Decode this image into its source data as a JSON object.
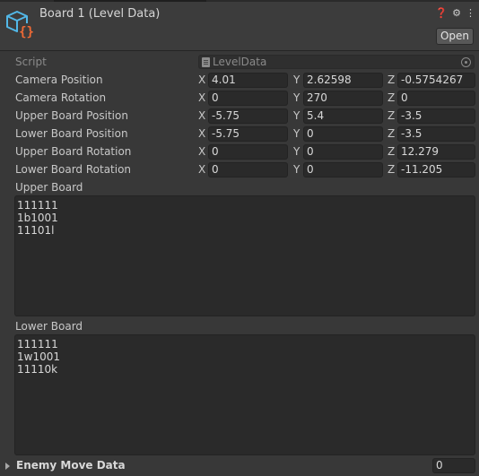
{
  "header": {
    "title": "Board 1 (Level Data)",
    "open_label": "Open",
    "icons": [
      "help-icon",
      "settings-sliders-icon",
      "more-vert-icon"
    ]
  },
  "script": {
    "label": "Script",
    "value": "LevelData"
  },
  "vectors": [
    {
      "label": "Camera Position",
      "x": "4.01",
      "y": "2.62598",
      "z": "-0.5754267"
    },
    {
      "label": "Camera Rotation",
      "x": "0",
      "y": "270",
      "z": "0"
    },
    {
      "label": "Upper Board Position",
      "x": "-5.75",
      "y": "5.4",
      "z": "-3.5"
    },
    {
      "label": "Lower Board Position",
      "x": "-5.75",
      "y": "0",
      "z": "-3.5"
    },
    {
      "label": "Upper Board Rotation",
      "x": "0",
      "y": "0",
      "z": "12.279"
    },
    {
      "label": "Lower Board Rotation",
      "x": "0",
      "y": "0",
      "z": "-11.205"
    }
  ],
  "axis_labels": {
    "x": "X",
    "y": "Y",
    "z": "Z"
  },
  "upper_board": {
    "label": "Upper Board",
    "lines": [
      "111111",
      "1b1001",
      "11101l"
    ]
  },
  "lower_board": {
    "label": "Lower Board",
    "lines": [
      "111111",
      "1w1001",
      "11110k"
    ]
  },
  "enemy_move_data": {
    "label": "Enemy Move Data",
    "count": "0"
  },
  "colors": {
    "background": "#383838",
    "field": "#2a2a2a",
    "icon_blue": "#52b8e8",
    "icon_orange": "#f06a35"
  }
}
